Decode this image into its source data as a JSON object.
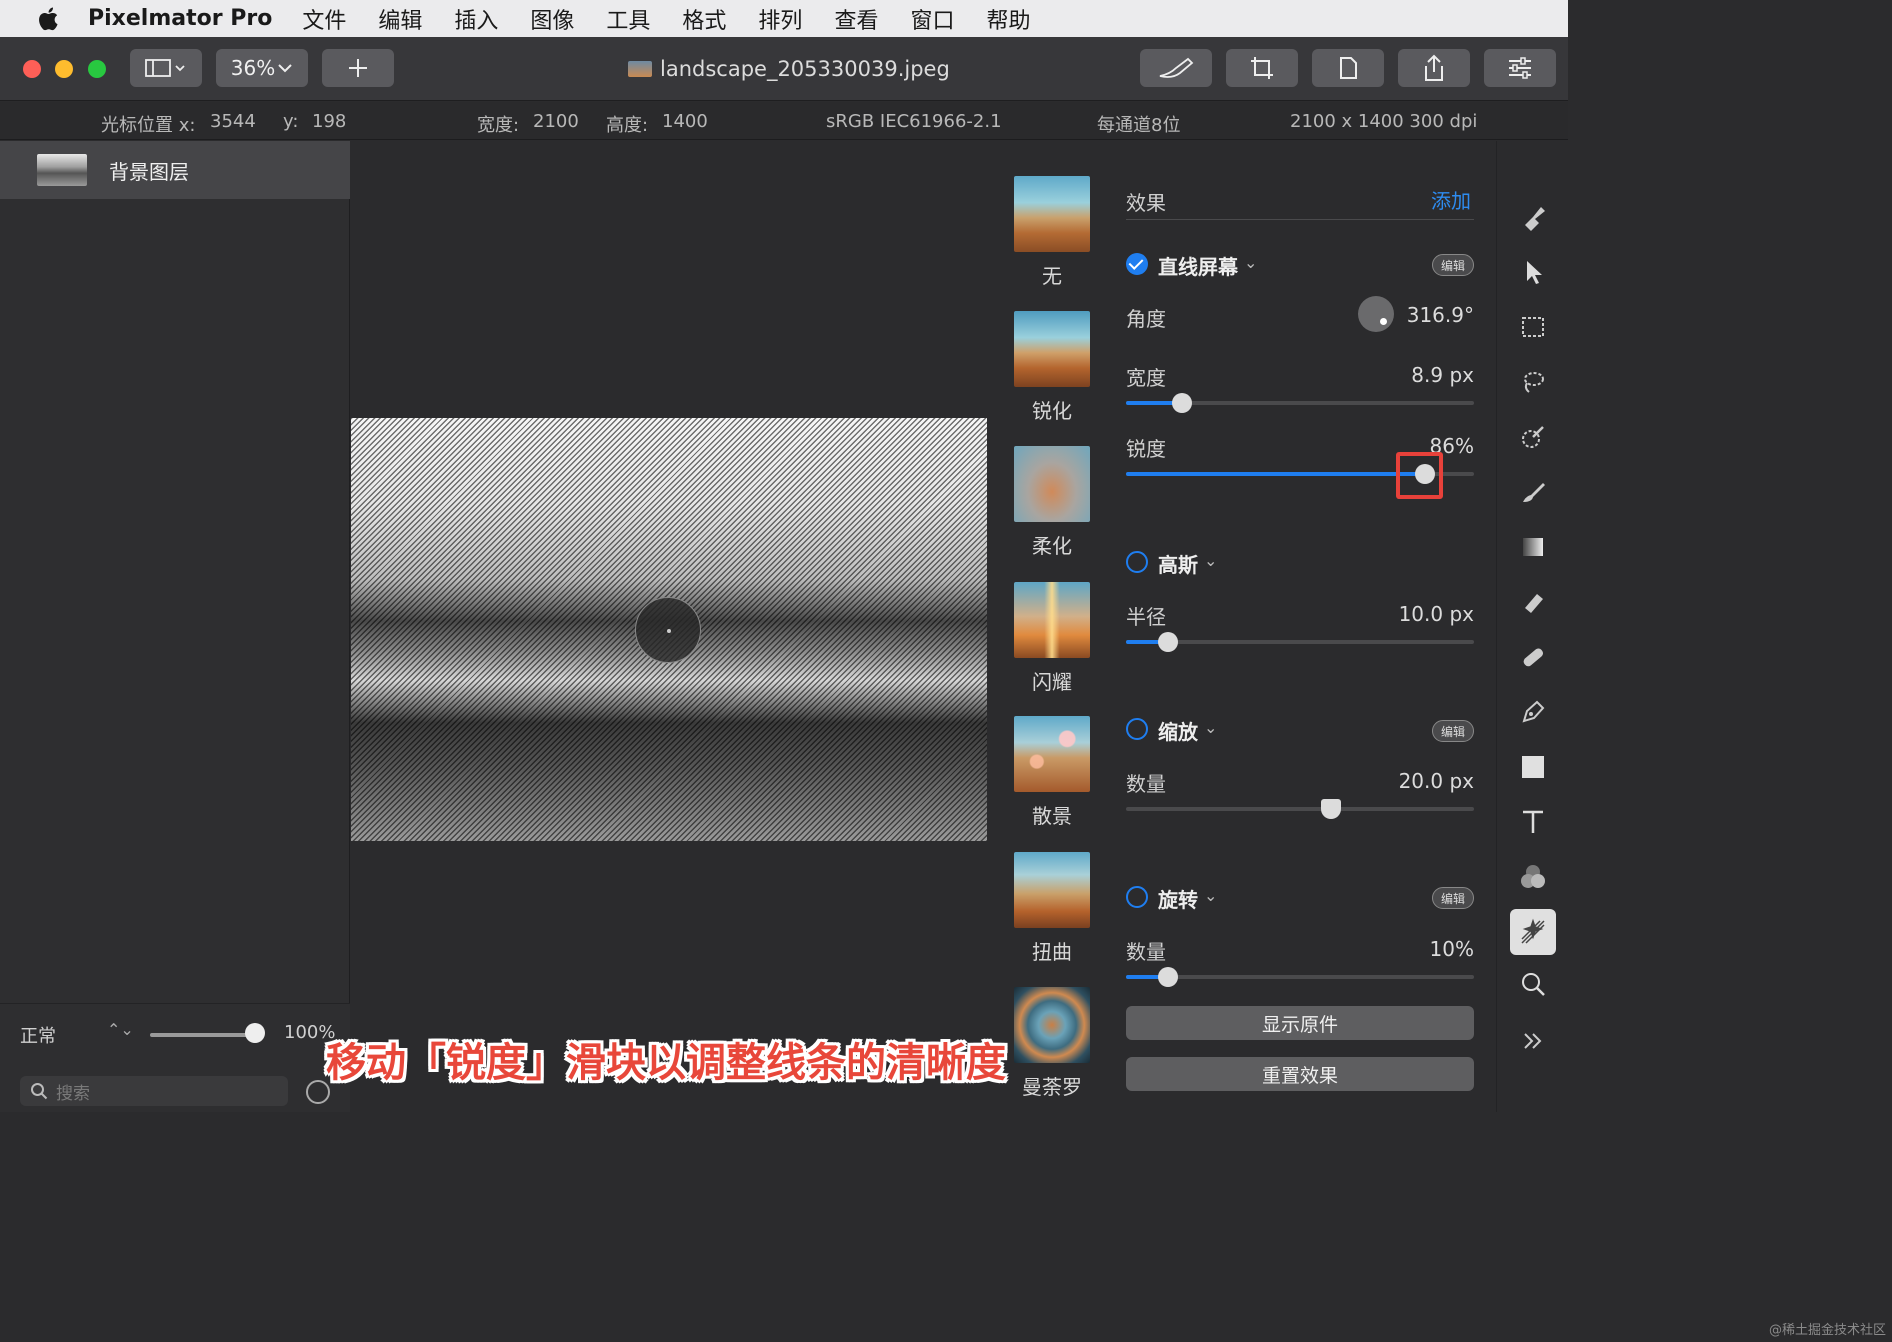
{
  "menubar": {
    "app": "Pixelmator Pro",
    "items": [
      "文件",
      "编辑",
      "插入",
      "图像",
      "工具",
      "格式",
      "排列",
      "查看",
      "窗口",
      "帮助"
    ]
  },
  "toolbar": {
    "zoom": "36%",
    "document_title": "landscape_205330039.jpeg",
    "traffic_colors": [
      "#fe5f57",
      "#febc2e",
      "#28c840"
    ]
  },
  "infobar": {
    "cursor_label": "光标位置 x:",
    "cursor_x": "3544",
    "cursor_y_label": "y:",
    "cursor_y": "198",
    "width_label": "宽度:",
    "width": "2100",
    "height_label": "高度:",
    "height": "1400",
    "profile": "sRGB IEC61966-2.1",
    "depth": "每通道8位",
    "size": "2100 x 1400 300 dpi"
  },
  "layers": {
    "items": [
      {
        "name": "背景图层"
      }
    ],
    "blend_mode": "正常",
    "opacity": "100%",
    "opacity_fraction": 1.0,
    "search_placeholder": "搜索"
  },
  "effects_browser": {
    "items": [
      {
        "label": "无"
      },
      {
        "label": "锐化"
      },
      {
        "label": "柔化"
      },
      {
        "label": "闪耀"
      },
      {
        "label": "散景"
      },
      {
        "label": "扭曲"
      },
      {
        "label": "曼荼罗"
      }
    ]
  },
  "panel": {
    "title": "效果",
    "add_label": "添加",
    "edit_label": "编辑",
    "effects": [
      {
        "name": "直线屏幕",
        "enabled": true,
        "params": [
          {
            "label": "角度",
            "value": "316.9°"
          },
          {
            "label": "宽度",
            "value": "8.9 px",
            "fraction": 0.16
          },
          {
            "label": "锐度",
            "value": "86%",
            "fraction": 0.86
          }
        ]
      },
      {
        "name": "高斯",
        "enabled": false,
        "params": [
          {
            "label": "半径",
            "value": "10.0 px",
            "fraction": 0.12
          }
        ]
      },
      {
        "name": "缩放",
        "enabled": false,
        "params": [
          {
            "label": "数量",
            "value": "20.0 px",
            "fraction": 0.59
          }
        ]
      },
      {
        "name": "旋转",
        "enabled": false,
        "params": [
          {
            "label": "数量",
            "value": "10%",
            "fraction": 0.12
          }
        ]
      }
    ],
    "show_original": "显示原件",
    "reset_effects": "重置效果"
  },
  "caption": "移动「锐度」滑块以调整线条的清晰度",
  "watermark": "@稀土掘金技术社区"
}
